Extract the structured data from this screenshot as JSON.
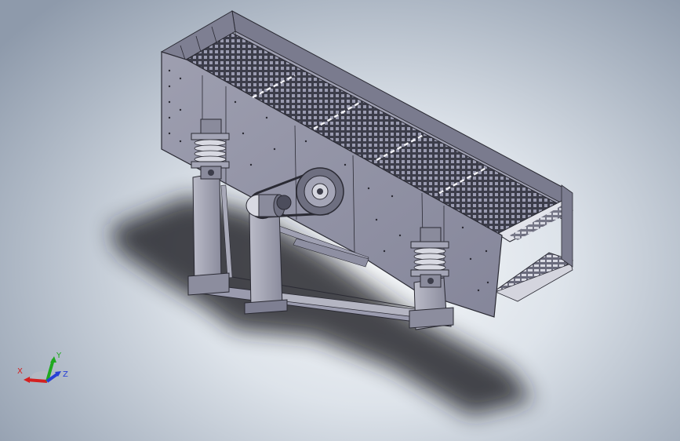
{
  "viewport": {
    "background_top": "#f6f8fa",
    "background_edge": "#8e9aab"
  },
  "model": {
    "body_color": "#8c8d9e",
    "body_dark": "#6c6d80",
    "body_light": "#a4a5b6",
    "mesh_color": "#3c3d4a",
    "shadow_color": "#1a1c22"
  },
  "triad": {
    "x_label": "X",
    "y_label": "Y",
    "z_label": "Z",
    "x_color": "#d42020",
    "y_color": "#1fa81f",
    "z_color": "#2840d6"
  }
}
